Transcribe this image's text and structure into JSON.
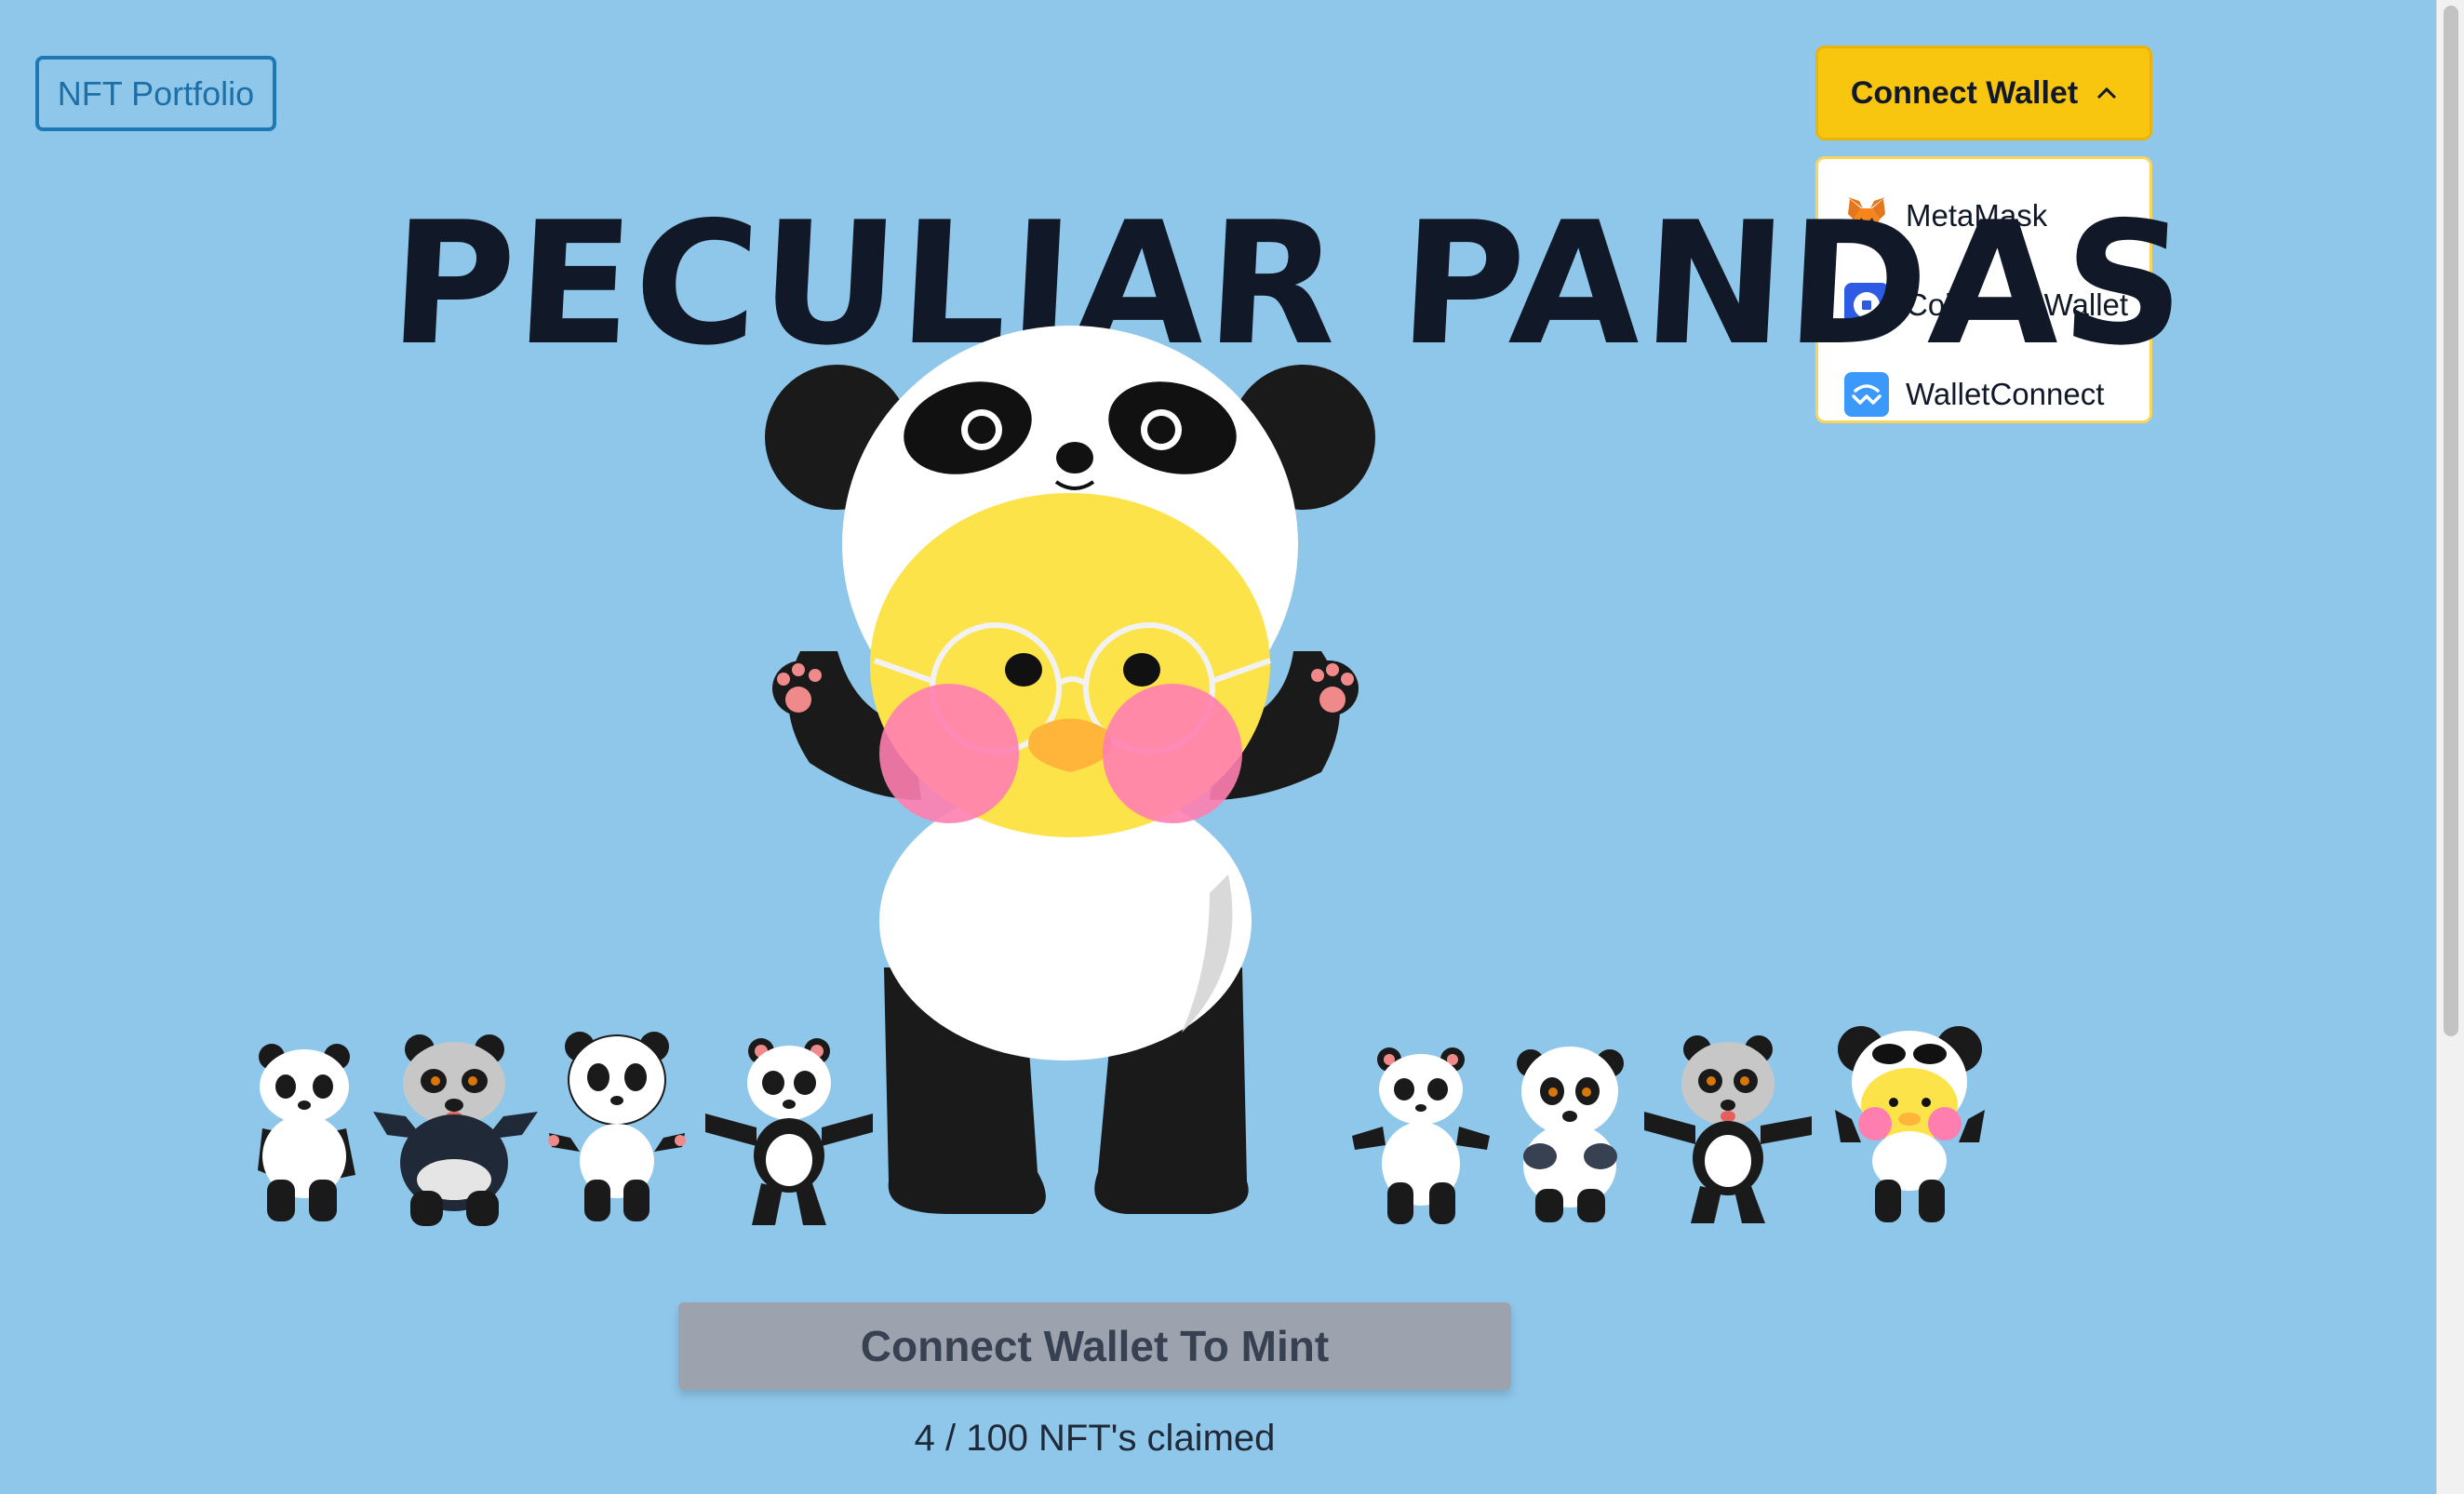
{
  "header": {
    "portfolio_label": "NFT Portfolio",
    "connect_label": "Connect Wallet",
    "connect_chevron": "^"
  },
  "wallet_menu": {
    "items": [
      {
        "label": "MetaMask",
        "icon": "metamask-fox-icon"
      },
      {
        "label": "Coinbase Wallet",
        "icon": "coinbase-icon"
      },
      {
        "label": "WalletConnect",
        "icon": "walletconnect-icon"
      }
    ]
  },
  "hero": {
    "title": "PECULIAR PANDAS"
  },
  "mint": {
    "button_label": "Connect Wallet To Mint",
    "claimed_text": "4 / 100 NFT's claimed"
  },
  "colors": {
    "background": "#8fc7ea",
    "accent_yellow": "#f9c60f",
    "portfolio_blue": "#1f78b4",
    "mint_disabled": "#9ca3af"
  }
}
